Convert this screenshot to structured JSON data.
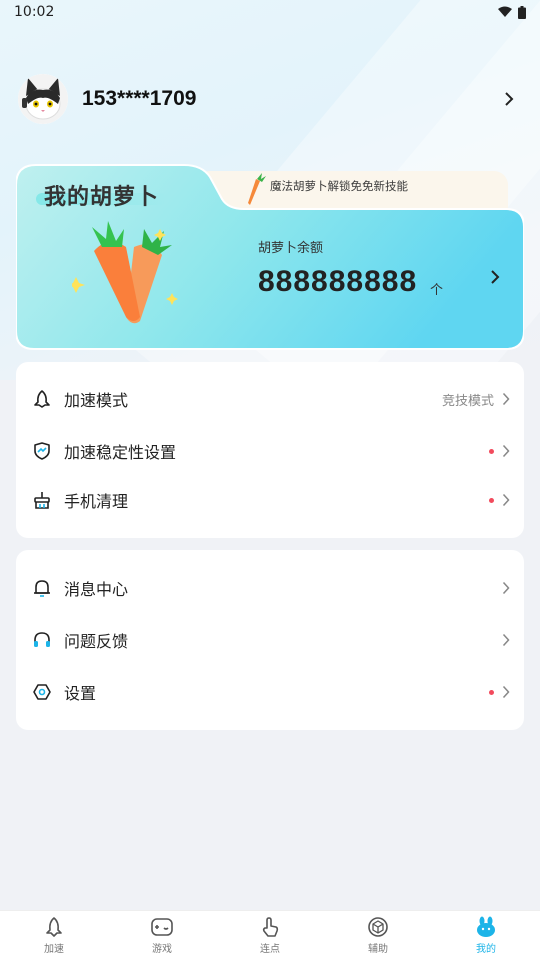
{
  "status": {
    "time": "10:02"
  },
  "profile": {
    "phone": "153****1709"
  },
  "carrot_card": {
    "title": "我的胡萝卜",
    "promo": "魔法胡萝卜解锁免免新技能",
    "balance_label": "胡萝卜余额",
    "balance_value": "888888888",
    "balance_unit": "个"
  },
  "menu_group_1": [
    {
      "label": "加速模式",
      "value": "竞技模式",
      "dot": false
    },
    {
      "label": "加速稳定性设置",
      "value": "",
      "dot": true
    },
    {
      "label": "手机清理",
      "value": "",
      "dot": true
    }
  ],
  "menu_group_2": [
    {
      "label": "消息中心",
      "dot": false
    },
    {
      "label": "问题反馈",
      "dot": false
    },
    {
      "label": "设置",
      "dot": true
    }
  ],
  "bottom_nav": [
    {
      "label": "加速",
      "icon": "speed-icon"
    },
    {
      "label": "游戏",
      "icon": "gamepad-icon"
    },
    {
      "label": "连点",
      "icon": "tap-icon"
    },
    {
      "label": "辅助",
      "icon": "cube-icon"
    },
    {
      "label": "我的",
      "icon": "rabbit-icon",
      "active": true
    }
  ],
  "colors": {
    "accent": "#1db4e8",
    "dot": "#f24a5c"
  }
}
